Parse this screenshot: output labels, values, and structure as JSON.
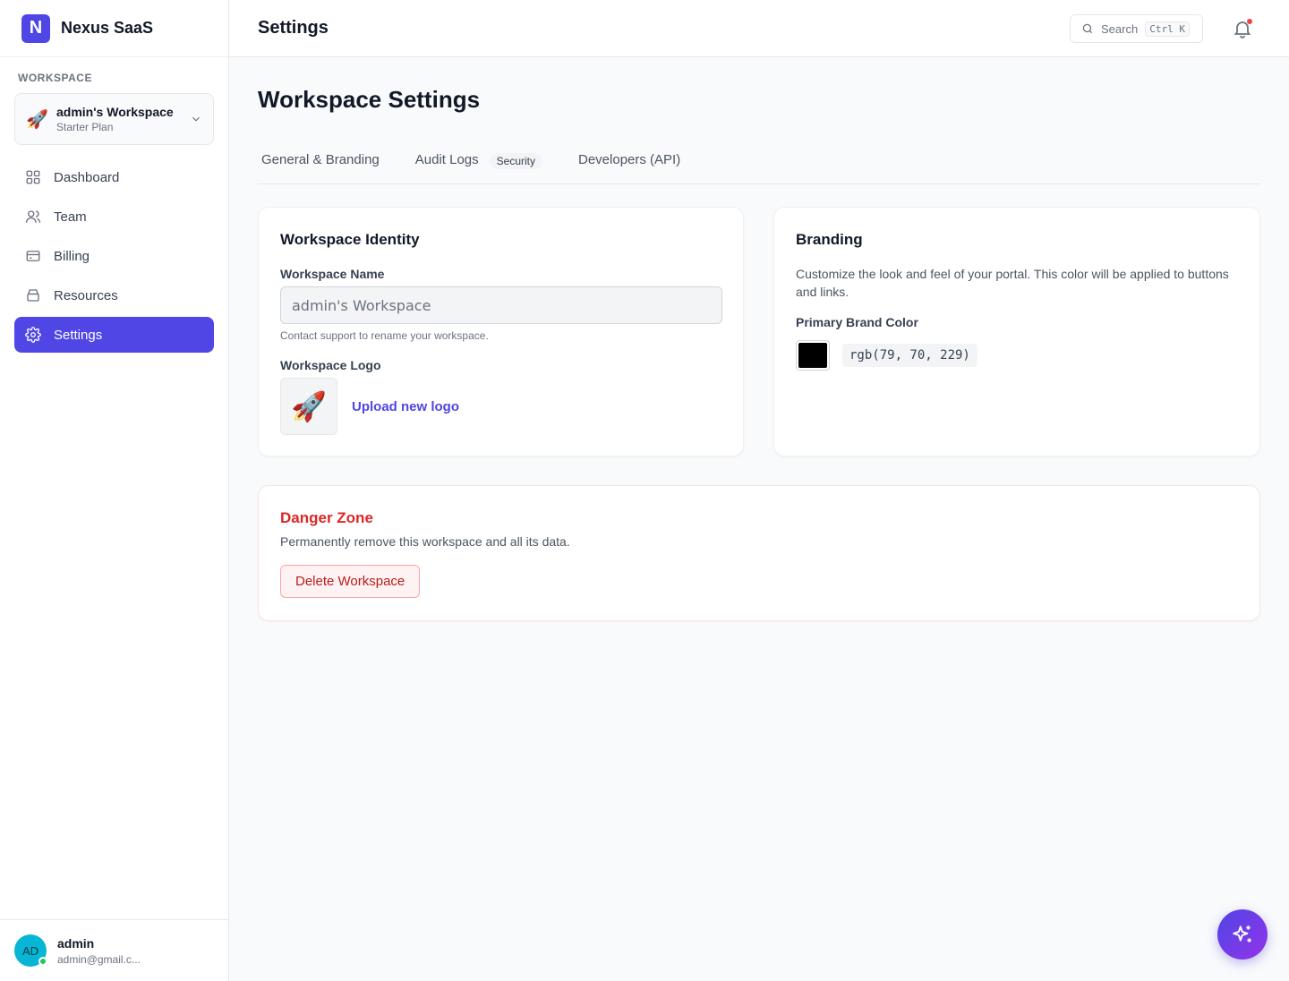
{
  "brand": {
    "logo_letter": "N",
    "name": "Nexus SaaS"
  },
  "workspace": {
    "section_label": "WORKSPACE",
    "emoji": "🚀",
    "name": "admin's Workspace",
    "plan": "Starter Plan"
  },
  "nav": {
    "items": [
      {
        "label": "Dashboard",
        "icon": "grid-icon"
      },
      {
        "label": "Team",
        "icon": "users-icon"
      },
      {
        "label": "Billing",
        "icon": "card-icon"
      },
      {
        "label": "Resources",
        "icon": "box-icon"
      },
      {
        "label": "Settings",
        "icon": "gear-icon",
        "active": true
      }
    ]
  },
  "user": {
    "initials": "AD",
    "name": "admin",
    "email": "admin@gmail.c..."
  },
  "topbar": {
    "title": "Settings",
    "search_label": "Search",
    "search_shortcut": "Ctrl K"
  },
  "page": {
    "title": "Workspace Settings"
  },
  "tabs": [
    {
      "label": "General & Branding"
    },
    {
      "label": "Audit Logs",
      "badge": "Security"
    },
    {
      "label": "Developers (API)"
    }
  ],
  "identity": {
    "title": "Workspace Identity",
    "name_label": "Workspace Name",
    "name_value": "admin's Workspace",
    "name_hint": "Contact support to rename your workspace.",
    "logo_label": "Workspace Logo",
    "logo_emoji": "🚀",
    "upload_label": "Upload new logo"
  },
  "branding": {
    "title": "Branding",
    "description": "Customize the look and feel of your portal. This color will be applied to buttons and links.",
    "color_label": "Primary Brand Color",
    "color_value": "rgb(79, 70, 229)",
    "swatch_color": "#000000"
  },
  "danger": {
    "title": "Danger Zone",
    "description": "Permanently remove this workspace and all its data.",
    "button_label": "Delete Workspace"
  },
  "colors": {
    "accent": "#4f46e5",
    "danger": "#dc2626"
  }
}
